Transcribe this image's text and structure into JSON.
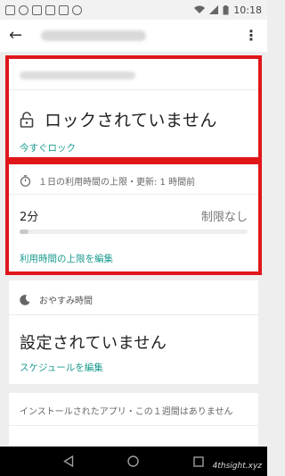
{
  "status_bar": {
    "time": "10:18"
  },
  "app_bar": {
    "back_icon": "arrow-back-icon",
    "overflow_icon": "more-vert-icon"
  },
  "lock_card": {
    "status_text": "ロックされていません",
    "action_label": "今すぐロック"
  },
  "usage_card": {
    "header": "１日の利用時間の上限・更新: 1 時間前",
    "used": "2分",
    "limit": "制限なし",
    "progress": 0.02,
    "action_label": "利用時間の上限を編集"
  },
  "bedtime_card": {
    "header": "おやすみ時間",
    "status_text": "設定されていません",
    "action_label": "スケジュールを編集"
  },
  "apps_card": {
    "header": "インストールされたアプリ・この１週間はありません"
  },
  "watermark": "4thsight.xyz",
  "colors": {
    "highlight": "#e0161b",
    "link": "#1a9a8e"
  }
}
